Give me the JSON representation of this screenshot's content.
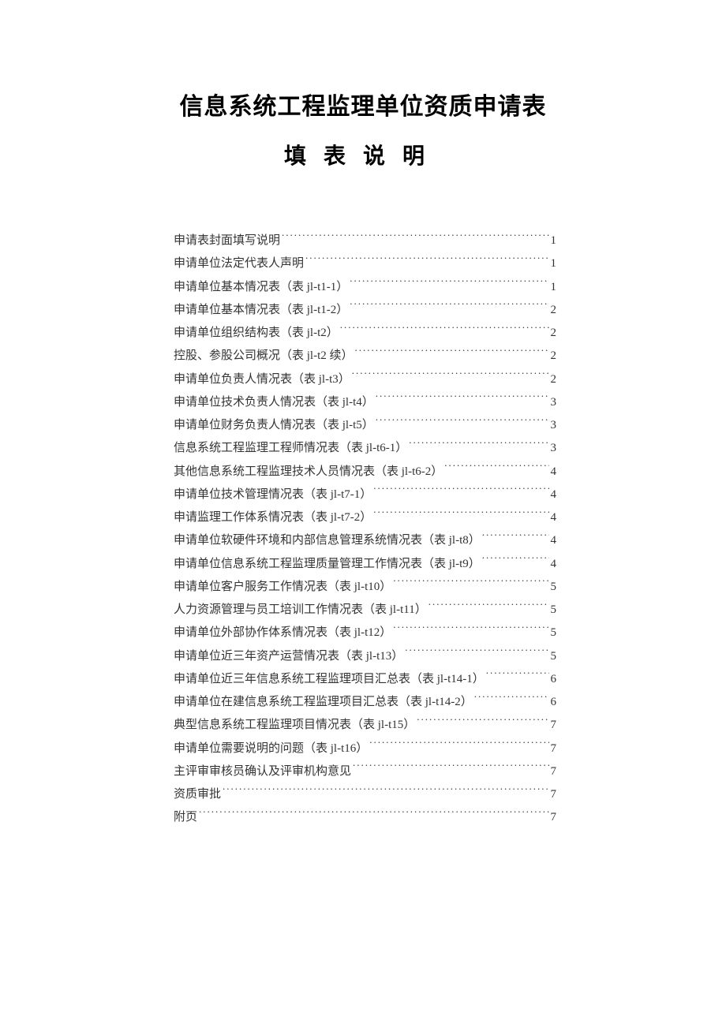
{
  "title_main": "信息系统工程监理单位资质申请表",
  "title_sub": "填表说明",
  "toc": [
    {
      "label": "申请表封面填写说明",
      "page": "1"
    },
    {
      "label": "申请单位法定代表人声明",
      "page": "1"
    },
    {
      "label": "申请单位基本情况表（表 jl-t1-1）",
      "page": "1"
    },
    {
      "label": "申请单位基本情况表（表 jl-t1-2）",
      "page": "2"
    },
    {
      "label": "申请单位组织结构表（表 jl-t2）",
      "page": "2"
    },
    {
      "label": "控股、参股公司概况（表 jl-t2 续）",
      "page": "2"
    },
    {
      "label": "申请单位负责人情况表（表 jl-t3）",
      "page": "2"
    },
    {
      "label": "申请单位技术负责人情况表（表 jl-t4）",
      "page": "3"
    },
    {
      "label": "申请单位财务负责人情况表（表 jl-t5）",
      "page": "3"
    },
    {
      "label": "信息系统工程监理工程师情况表（表 jl-t6-1）",
      "page": "3"
    },
    {
      "label": "其他信息系统工程监理技术人员情况表（表 jl-t6-2）",
      "page": "4"
    },
    {
      "label": "申请单位技术管理情况表（表 jl-t7-1）",
      "page": "4"
    },
    {
      "label": "申请监理工作体系情况表（表 jl-t7-2）",
      "page": "4"
    },
    {
      "label": "申请单位软硬件环境和内部信息管理系统情况表（表 jl-t8）",
      "page": "4"
    },
    {
      "label": "申请单位信息系统工程监理质量管理工作情况表（表 jl-t9）",
      "page": "4"
    },
    {
      "label": "申请单位客户服务工作情况表（表 jl-t10）",
      "page": "5"
    },
    {
      "label": "人力资源管理与员工培训工作情况表（表 jl-t11）",
      "page": "5"
    },
    {
      "label": "申请单位外部协作体系情况表（表 jl-t12）",
      "page": "5"
    },
    {
      "label": "申请单位近三年资产运营情况表（表 jl-t13）",
      "page": "5"
    },
    {
      "label": "申请单位近三年信息系统工程监理项目汇总表（表 jl-t14-1）",
      "page": "6"
    },
    {
      "label": "申请单位在建信息系统工程监理项目汇总表（表 jl-t14-2）",
      "page": "6"
    },
    {
      "label": "典型信息系统工程监理项目情况表（表 jl-t15）",
      "page": "7"
    },
    {
      "label": "申请单位需要说明的问题（表 jl-t16）",
      "page": "7"
    },
    {
      "label": "主评审审核员确认及评审机构意见",
      "page": "7"
    },
    {
      "label": "资质审批",
      "page": "7"
    },
    {
      "label": "附页",
      "page": "7"
    }
  ]
}
